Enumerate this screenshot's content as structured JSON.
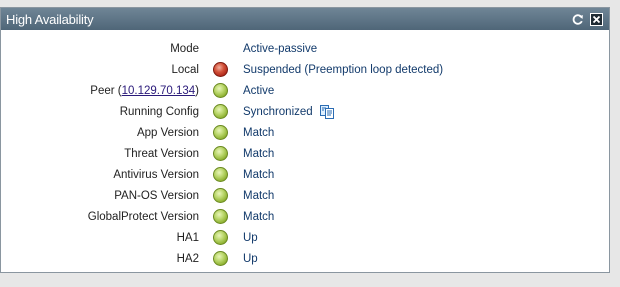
{
  "widget": {
    "title": "High Availability"
  },
  "header": {
    "refresh_icon": "refresh-icon",
    "close_icon": "close-icon"
  },
  "mode": {
    "label": "Mode",
    "value": "Active-passive"
  },
  "local": {
    "label": "Local",
    "status": "red",
    "value": "Suspended (Preemption loop detected)"
  },
  "peer": {
    "label_prefix": "Peer (",
    "address": "10.129.70.134",
    "label_suffix": ")",
    "status": "green",
    "value": "Active"
  },
  "running_config": {
    "label": "Running Config",
    "status": "green",
    "value": "Synchronized",
    "icon": "sync-config-icon"
  },
  "app_version": {
    "label": "App Version",
    "status": "green",
    "value": "Match"
  },
  "threat_version": {
    "label": "Threat Version",
    "status": "green",
    "value": "Match"
  },
  "antivirus_version": {
    "label": "Antivirus Version",
    "status": "green",
    "value": "Match"
  },
  "panos_version": {
    "label": "PAN-OS Version",
    "status": "green",
    "value": "Match"
  },
  "globalprotect_version": {
    "label": "GlobalProtect Version",
    "status": "green",
    "value": "Match"
  },
  "ha1": {
    "label": "HA1",
    "status": "green",
    "value": "Up"
  },
  "ha2": {
    "label": "HA2",
    "status": "green",
    "value": "Up"
  },
  "colors": {
    "header_top": "#6f8596",
    "header_bottom": "#4f6678",
    "value_text": "#123a6b",
    "status_green": "#8db030",
    "status_red": "#b0281a"
  }
}
